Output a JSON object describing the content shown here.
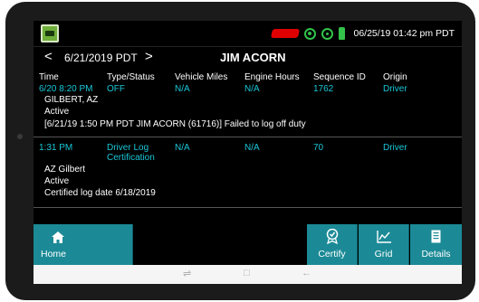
{
  "status_bar": {
    "datetime": "06/25/19 01:42 pm PDT",
    "icons": [
      "app-icon",
      "truck-icon",
      "gps-icon",
      "signal-icon",
      "plug-icon"
    ],
    "accent_colors": {
      "truck": "#e00000",
      "indicator": "#33c24a"
    }
  },
  "header": {
    "prev": "<",
    "date": "6/21/2019 PDT",
    "next": ">",
    "driver": "JIM ACORN"
  },
  "table": {
    "columns": [
      "Time",
      "Type/Status",
      "Vehicle Miles",
      "Engine Hours",
      "Sequence ID",
      "Origin"
    ],
    "rows": [
      {
        "time": "6/20 8:20 PM",
        "type": "OFF",
        "miles": "N/A",
        "hours": "N/A",
        "sequence": "1762",
        "origin": "Driver",
        "location": "GILBERT, AZ",
        "status": "Active",
        "note": "[6/21/19 1:50 PM PDT JIM ACORN (61716)] Failed to log off duty"
      },
      {
        "time": "1:31 PM",
        "type_line1": "Driver Log",
        "type_line2": "Certification",
        "miles": "N/A",
        "hours": "N/A",
        "sequence": "70",
        "origin": "Driver",
        "location": "AZ Gilbert",
        "status": "Active",
        "note": "Certified log date 6/18/2019"
      }
    ],
    "cell_color": "#19c7d8"
  },
  "toolbar": {
    "home": "Home",
    "certify": "Certify",
    "grid": "Grid",
    "details": "Details",
    "color": "#1b8a96"
  },
  "android_nav": {
    "back": "←",
    "home": "□",
    "recents": "⇌"
  }
}
